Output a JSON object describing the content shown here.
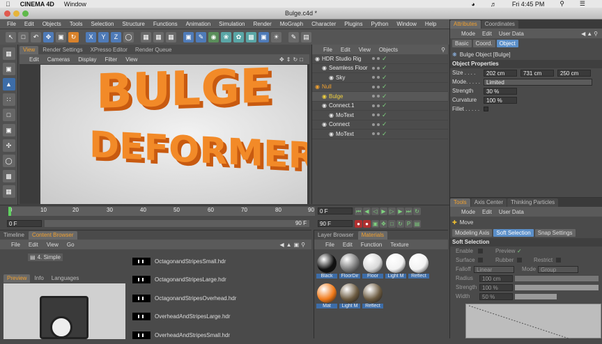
{
  "os_menubar": {
    "app": "CINEMA 4D",
    "window": "Window",
    "clock": "Fri 4:45 PM"
  },
  "window_title": "Bulge.c4d *",
  "menu": [
    "File",
    "Edit",
    "Objects",
    "Tools",
    "Selection",
    "Structure",
    "Functions",
    "Animation",
    "Simulation",
    "Render",
    "MoGraph",
    "Character",
    "Plugins",
    "Python",
    "Window",
    "Help"
  ],
  "toolbar_axes": [
    "X",
    "Y",
    "Z"
  ],
  "view_tabs": [
    "View",
    "Render Settings",
    "XPresso Editor",
    "Render Queue"
  ],
  "view_menu": [
    "Edit",
    "Cameras",
    "Display",
    "Filter",
    "View"
  ],
  "render_text": {
    "line1": "BULGE",
    "line2": "DEFORMER"
  },
  "object_manager": {
    "menu": [
      "File",
      "Edit",
      "View",
      "Objects"
    ],
    "objects": [
      {
        "name": "HDR Studio Rig",
        "indent": 0,
        "color": "#e8e8e8"
      },
      {
        "name": "Seamless Floor",
        "indent": 1,
        "color": "#e8e8e8"
      },
      {
        "name": "Sky",
        "indent": 2,
        "color": "#e8e8e8"
      },
      {
        "name": "Null",
        "indent": 0,
        "color": "#f0a030"
      },
      {
        "name": "Bulge",
        "indent": 1,
        "color": "#f0d040"
      },
      {
        "name": "Connect.1",
        "indent": 1,
        "color": "#e8e8e8"
      },
      {
        "name": "MoText",
        "indent": 2,
        "color": "#e8e8e8"
      },
      {
        "name": "Connect",
        "indent": 1,
        "color": "#e8e8e8"
      },
      {
        "name": "MoText",
        "indent": 2,
        "color": "#e8e8e8"
      }
    ]
  },
  "attributes": {
    "tabs": [
      "Attributes",
      "Coordinates"
    ],
    "menu": [
      "Mode",
      "Edit",
      "User Data"
    ],
    "modes": [
      "Basic",
      "Coord.",
      "Object"
    ],
    "object_title": "Bulge Object [Bulge]",
    "section": "Object Properties",
    "size_label": "Size . . . .",
    "size": [
      "202 cm",
      "731 cm",
      "250 cm"
    ],
    "mode_label": "Mode. . . . .",
    "mode_value": "Limited",
    "strength_label": "Strength",
    "strength_value": "30 %",
    "curvature_label": "Curvature",
    "curvature_value": "100 %",
    "fillet_label": "Fillet . . . . ."
  },
  "timeline": {
    "ticks": [
      "0",
      "10",
      "20",
      "30",
      "40",
      "50",
      "60",
      "70",
      "80",
      "90"
    ],
    "frame_left": "0 F",
    "frame_end": "90 F",
    "frame_right": "0 F",
    "frame_total": "90 F",
    "frame_min": "0 F"
  },
  "content_browser": {
    "tabs": [
      "Timeline",
      "Content Browser"
    ],
    "menu": [
      "File",
      "Edit",
      "View",
      "Go"
    ],
    "folder": "4. Simple",
    "preview_tabs": [
      "Preview",
      "Info",
      "Languages"
    ],
    "files": [
      "OctagonandStripesSmall.hdr",
      "OctagonandStripesLarge.hdr",
      "OctagonandStripesOverhead.hdr",
      "OverheadAndStripesLarge.hdr",
      "OverheadAndStripesSmall.hdr"
    ]
  },
  "materials": {
    "tabs": [
      "Layer Browser",
      "Materials"
    ],
    "menu": [
      "File",
      "Edit",
      "Function",
      "Texture"
    ],
    "items": [
      {
        "name": "Black",
        "color": "#111111"
      },
      {
        "name": "FloorDir",
        "color": "#7a7a7a"
      },
      {
        "name": "Floor",
        "color": "#d8d8d8"
      },
      {
        "name": "Light M",
        "color": "#f2f2f2"
      },
      {
        "name": "Reflect",
        "color": "#f2f2f2"
      },
      {
        "name": "Mat",
        "color": "#f07a1a"
      },
      {
        "name": "Light M",
        "color": "#6b5a40"
      },
      {
        "name": "Reflect",
        "color": "#6b5a40"
      }
    ]
  },
  "tools_panel": {
    "tabs": [
      "Tools",
      "Axis Center",
      "Thinking Particles"
    ],
    "menu": [
      "Mode",
      "Edit",
      "User Data"
    ],
    "move": "Move",
    "modes": [
      "Modeling Axis",
      "Soft Selection",
      "Snap Settings"
    ],
    "section": "Soft Selection",
    "enable": "Enable",
    "preview": "Preview",
    "surface": "Surface",
    "rubber": "Rubber",
    "restrict": "Restrict",
    "falloff_label": "Falloff",
    "falloff_value": "Linear",
    "mode_label": "Mode",
    "mode_value": "Group",
    "radius_label": "Radius",
    "radius_value": "100 cm",
    "strength_label": "Strength",
    "strength_value": "100 %",
    "width_label": "Width",
    "width_value": "50 %"
  },
  "accent": "#f0a030",
  "selection_blue": "#5b8fc9"
}
